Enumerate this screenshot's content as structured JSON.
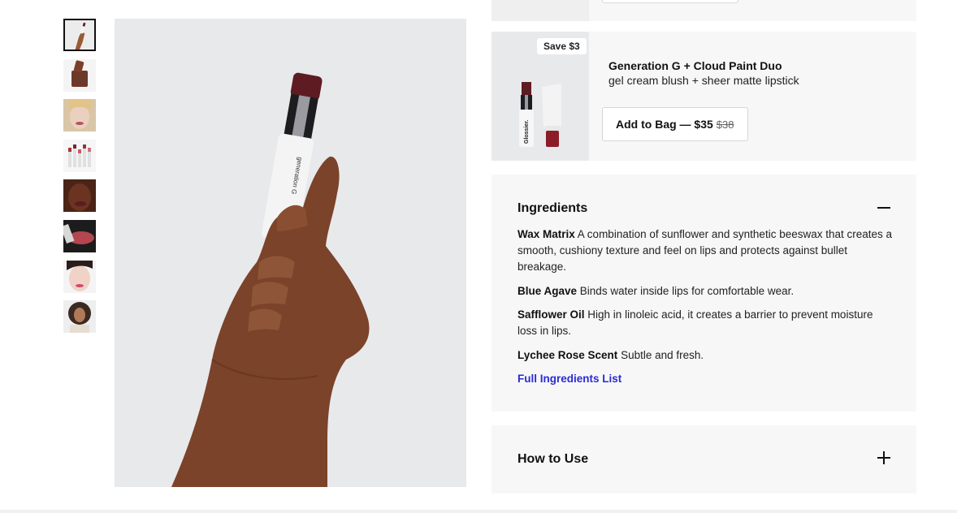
{
  "gallery": {
    "thumbnails": [
      {
        "alt": "hand holding lipstick"
      },
      {
        "alt": "lipstick swatch"
      },
      {
        "alt": "model face"
      },
      {
        "alt": "lipstick shades"
      },
      {
        "alt": "model face deep skin"
      },
      {
        "alt": "lips close-up"
      },
      {
        "alt": "model face pink lips"
      },
      {
        "alt": "model with curly hair"
      }
    ],
    "main_image_brand_text": "generation G"
  },
  "bundle": {
    "badge": "Save $3",
    "title": "Generation G + Cloud Paint Duo",
    "subtitle": "gel cream blush + sheer matte lipstick",
    "button_label": "Add to Bag — $35",
    "old_price": "$38",
    "product_brand_text": "Glossier."
  },
  "ingredients": {
    "heading": "Ingredients",
    "items": [
      {
        "name": "Wax Matrix",
        "desc": "A combination of sunflower and synthetic beeswax that creates a smooth, cushiony texture and feel on lips and protects against bullet breakage."
      },
      {
        "name": "Blue Agave",
        "desc": "Binds water inside lips for comfortable wear."
      },
      {
        "name": "Safflower Oil",
        "desc": "High in linoleic acid, it creates a barrier to prevent moisture loss in lips."
      },
      {
        "name": "Lychee Rose Scent",
        "desc": "Subtle and fresh."
      }
    ],
    "link": "Full Ingredients List"
  },
  "how_to_use": {
    "heading": "How to Use"
  },
  "colors": {
    "link": "#2b2bd4",
    "card_bg": "#f7f7f7",
    "image_bg": "#e8e9eb"
  }
}
